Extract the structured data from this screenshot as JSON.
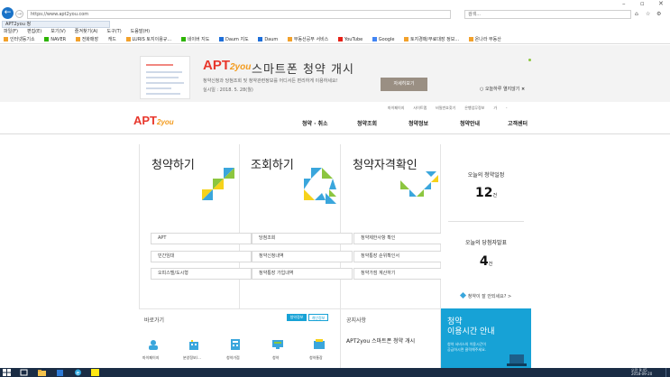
{
  "browser": {
    "url": "https://www.apt2you.com",
    "search_placeholder": "검색...",
    "tab_title": "APT2you 청",
    "menu": [
      "파일(F)",
      "편집(E)",
      "보기(V)",
      "즐겨찾기(A)",
      "도구(T)",
      "도움말(H)"
    ],
    "favorites": [
      "인터넷등기소",
      "NAVER",
      "전화매장",
      "캐드",
      "LURIS 토지이용규...",
      "네이버 지도",
      "Daum 지도",
      "Daum",
      "부동산공부 서비스",
      "YouTube",
      "Google",
      "토지경매/무료대장 정보...",
      "온나라 부동산",
      "온라인 - 브리우저정보..."
    ],
    "right_tools": [
      "페이지(P)",
      "안전(S)",
      "도구(O)"
    ]
  },
  "banner": {
    "logo_main": "APT",
    "logo_sub": "2you",
    "title": "스마트폰 청약 개시",
    "desc": "청약신청과 당첨조회 및 청약관련정보를 어디서든 편리하게 이용하세요!",
    "date": "실시일 : 2018. 5. 28(월)",
    "detail_button": "자세히보기",
    "hide_today": "오늘하루 열지않기",
    "close_icon": "×"
  },
  "header": {
    "util_links": [
      "마이페이지",
      "사이트맵",
      "비밀번호찾기",
      "은행업무정보",
      "가",
      "-"
    ],
    "logo_main": "APT",
    "logo_sub": "2you",
    "nav": [
      "청약 · 취소",
      "청약조회",
      "청약정보",
      "청약안내",
      "고객센터"
    ]
  },
  "panels": [
    {
      "title": "청약하기",
      "links": [
        "APT",
        "민간임대",
        "오피스텔/도시형"
      ]
    },
    {
      "title": "조회하기",
      "links": [
        "당첨조회",
        "청약신청내역",
        "청약통장 가입내역"
      ]
    },
    {
      "title": "청약자격확인",
      "links": [
        "청약제한사항 확인",
        "청약통장 순위확인서",
        "청약가점 계산하기"
      ]
    }
  ],
  "side": {
    "schedule_title": "오늘의 청약일정",
    "schedule_count": "12",
    "schedule_unit": "건",
    "winners_title": "오늘의 당첨자발표",
    "winners_count": "4",
    "winners_unit": "건",
    "faq": "청약이 잘 안되세요? >"
  },
  "quick": {
    "title": "바로가기",
    "toggle_on": "청약정보",
    "toggle_off": "개인정보",
    "items": [
      "마이페이지",
      "분양정보/...",
      "청약가점",
      "청약",
      "청약통장"
    ]
  },
  "notice": {
    "title": "공지사항",
    "text": "APT2you 스마트폰 청약 개시"
  },
  "promo": {
    "title_line1": "청약",
    "title_line2": "이용시간 안내",
    "text_line1": "청약 서비스의 이용시간이",
    "text_line2": "공급하시면 클릭해주세요."
  },
  "taskbar": {
    "clock_time": "오전 9:45",
    "clock_date": "2018-09-20"
  },
  "colors": {
    "brand_red": "#e8372c",
    "brand_orange": "#f39b1e",
    "panel_green": "#8cc63f",
    "panel_blue": "#3aa6dc",
    "panel_yellow": "#f6d21b",
    "promo_blue": "#17a2d6"
  }
}
